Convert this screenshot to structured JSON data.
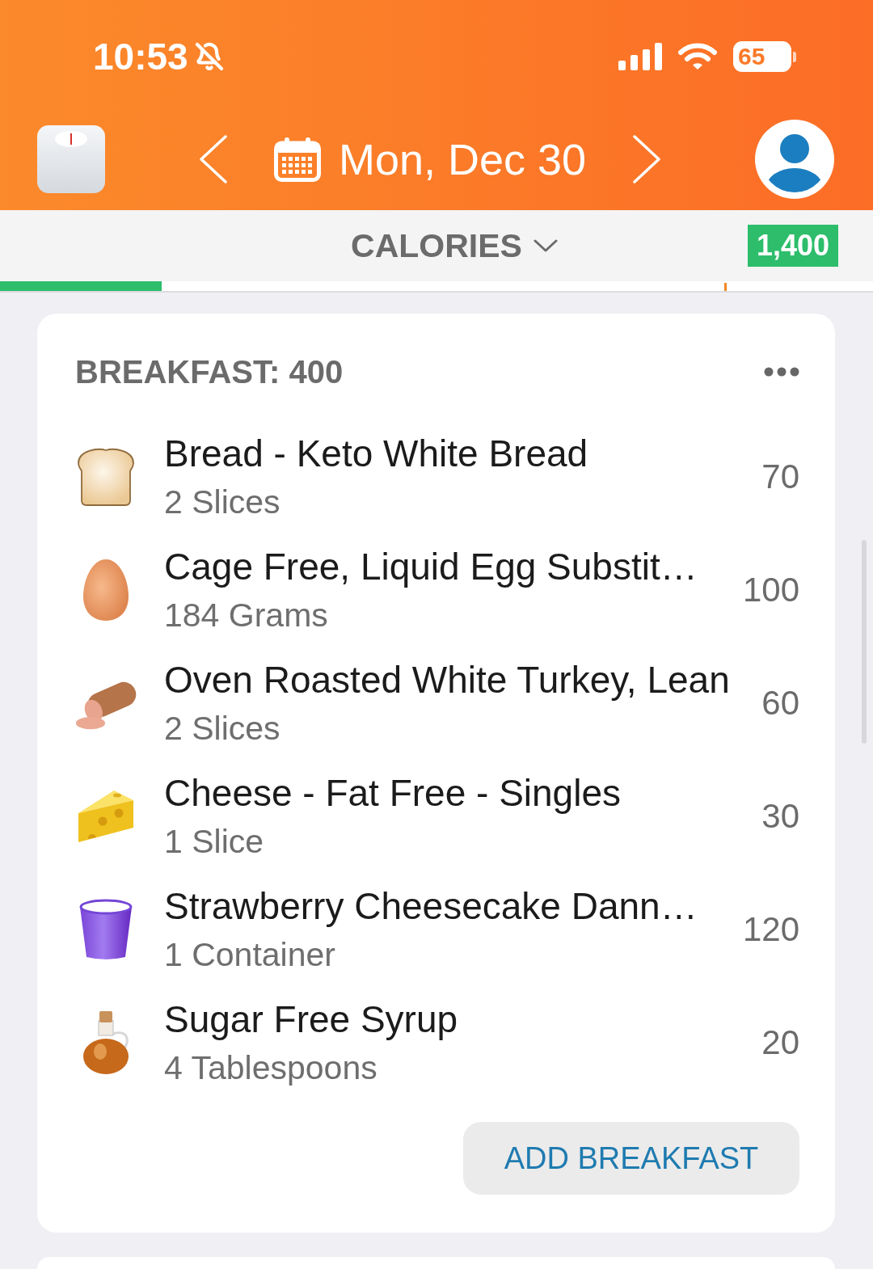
{
  "status_bar": {
    "time": "10:53",
    "battery": "65"
  },
  "nav": {
    "date": "Mon, Dec 30"
  },
  "summary": {
    "label": "CALORIES",
    "goal": "1,400",
    "progress": {
      "level": 0.185,
      "marker": {
        "level": 0.83
      }
    }
  },
  "meal": {
    "title": "BREAKFAST: 400",
    "items": [
      {
        "kind": "bread",
        "name": "Bread - Keto White Bread",
        "serving": "2 Slices",
        "calories": "70"
      },
      {
        "kind": "egg",
        "name": "Cage Free, Liquid Egg Substit…",
        "serving": "184 Grams",
        "calories": "100"
      },
      {
        "kind": "sausage",
        "name": "Oven Roasted White Turkey, Lean",
        "serving": "2 Slices",
        "calories": "60"
      },
      {
        "kind": "cheese",
        "name": "Cheese - Fat Free - Singles",
        "serving": "1 Slice",
        "calories": "30"
      },
      {
        "kind": "cup",
        "name": "Strawberry Cheesecake Dann…",
        "serving": "1 Container",
        "calories": "120"
      },
      {
        "kind": "bottle",
        "name": "Sugar Free Syrup",
        "serving": "4 Tablespoons",
        "calories": "20"
      }
    ],
    "add_button": "ADD BREAKFAST"
  }
}
